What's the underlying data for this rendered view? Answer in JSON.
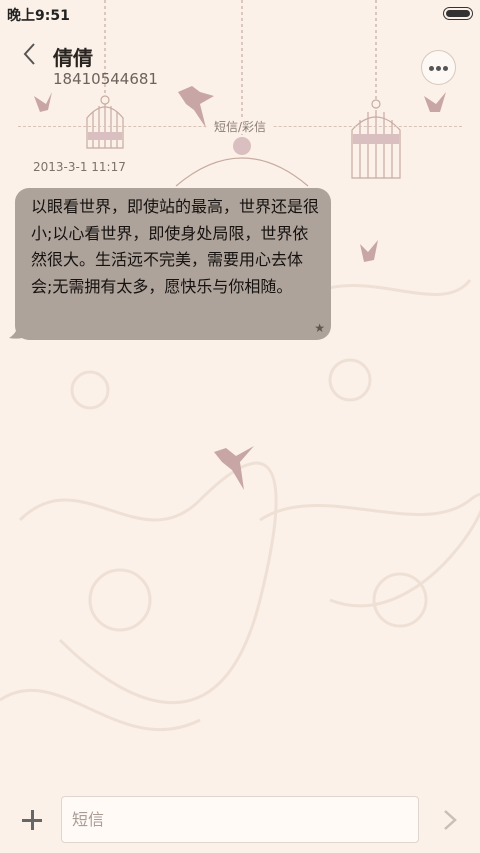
{
  "status_bar": {
    "time": "晚上9:51",
    "battery_icon": "battery-icon"
  },
  "header": {
    "back_icon": "chevron-left-icon",
    "contact_name": "倩倩",
    "phone_number": "18410544681",
    "more_icon": "more-dots-icon"
  },
  "divider": {
    "label": "短信/彩信"
  },
  "messages": [
    {
      "timestamp": "2013-3-1 11:17",
      "text": "以眼看世界，即使站的最高，世界还是很小;以心看世界，即使身处局限，世界依然很大。生活远不完美，需要用心去体会;无需拥有太多，愿快乐与你相随。",
      "star": "★"
    }
  ],
  "composer": {
    "add_icon": "plus-icon",
    "placeholder": "短信",
    "value": "",
    "send_icon": "send-arrow-icon"
  },
  "colors": {
    "background": "#fbf1e8",
    "bubble": "#aea39b",
    "accent": "#a8868a"
  }
}
